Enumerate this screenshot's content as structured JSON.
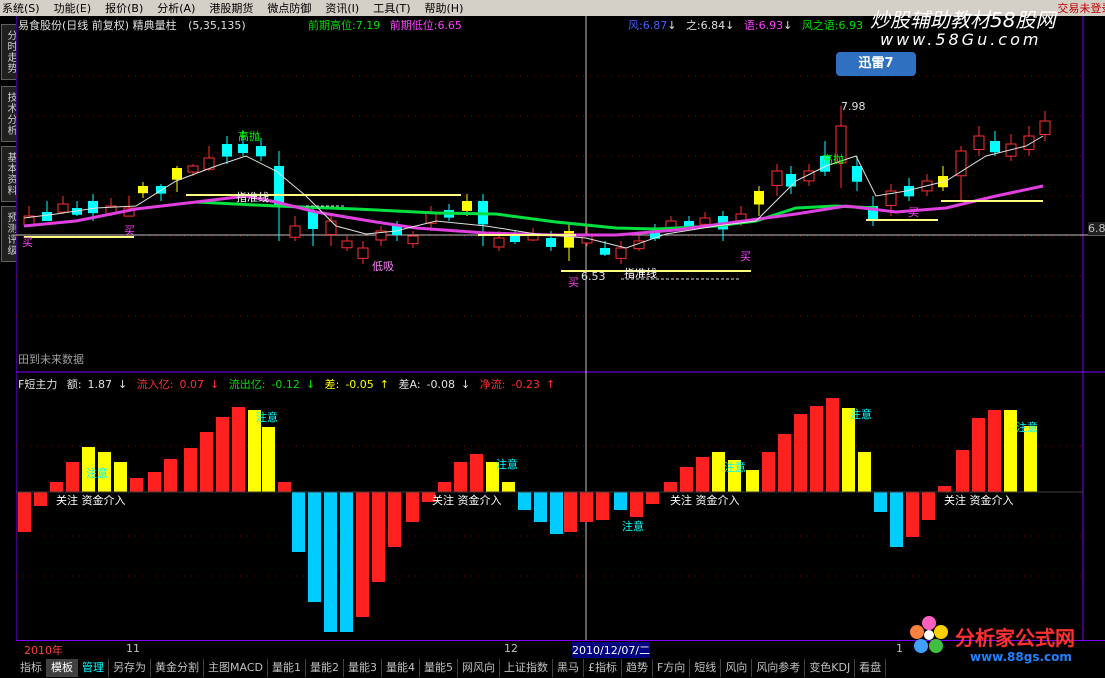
{
  "menubar": {
    "items": [
      "系统(S)",
      "功能(E)",
      "报价(B)",
      "分析(A)",
      "港股期货",
      "微点防御",
      "资讯(I)",
      "工具(T)",
      "帮助(H)"
    ],
    "status": "交易未登录  易食股份"
  },
  "sidetabs": [
    "分时走势",
    "技术分析",
    "基本资料",
    "预测评级"
  ],
  "title": {
    "stock": "易食股份(日线 前复权) 精典量柱",
    "params": "(5,35,135)",
    "prev_high_label": "前期高位:",
    "prev_high": "7.19",
    "prev_low_label": "前期低位:",
    "prev_low": "6.65",
    "right1_label": "风:",
    "right1": "6.87",
    "right2_label": "之:",
    "right2": "6.84",
    "right3_label": "语:",
    "right3": "6.93",
    "right4_label": "风之语:",
    "right4": "6.93"
  },
  "annotations": {
    "high_sell": "高抛",
    "low_buy": "低吸",
    "support_line": "指准线",
    "buy1": "买",
    "buy2": "买",
    "buy3": "买",
    "buy4": "买",
    "buy5": "买",
    "price_high": "7.98",
    "price_low": "6.53",
    "no_data": "田到未来数据",
    "side_price": "6.8"
  },
  "indicator": {
    "name": "F短主力",
    "e1_label": "额:",
    "e1": "1.87",
    "e2_label": "流入亿:",
    "e2": "0.07",
    "e3_label": "流出亿:",
    "e3": "-0.12",
    "e4_label": "差:",
    "e4": "-0.05",
    "e5_label": "差A:",
    "e5": "-0.08",
    "e6_label": "净流:",
    "e6": "-0.23",
    "notes": [
      "关注 资金介入",
      "注意",
      "注意",
      "关注 资金介入",
      "注意",
      "注意",
      "关注 资金介入",
      "注意",
      "注意",
      "关注 资金介入",
      "注意"
    ]
  },
  "timebar": {
    "year": "2010年",
    "m11": "11",
    "m12": "12",
    "cursor_date": "2010/12/07/二",
    "m1": "1"
  },
  "bottomtabs": [
    "指标",
    "模板",
    "管理",
    "另存为",
    "黄金分割",
    "主图MACD",
    "量能1",
    "量能2",
    "量能3",
    "量能4",
    "量能5",
    "网风向",
    "上证指数",
    "黑马",
    "£指标",
    "趋势",
    "F方向",
    "短线",
    "风向",
    "风向参考",
    "变色KDJ",
    "看盘"
  ],
  "watermark": {
    "top": "炒股辅助教材58股网",
    "url": "www.58Gu.com",
    "xunlei": "迅雷7",
    "bottom": "分析家公式网",
    "bottom_url": "www.88gs.com"
  },
  "colors": {
    "up": "#ff3030",
    "down": "#00ffff",
    "yellow": "#ffff00",
    "ma_green": "#00e040",
    "ma_mag": "#e040e0",
    "border": "#8000ff"
  }
}
